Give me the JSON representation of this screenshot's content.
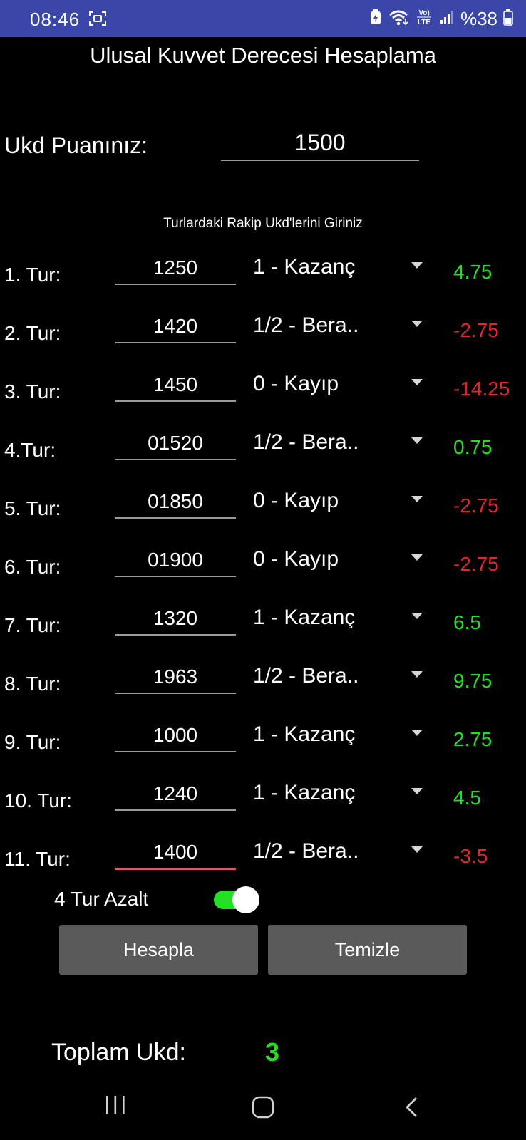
{
  "status_bar": {
    "time": "08:46",
    "battery_text": "%38",
    "left_icon": "screen-capture-icon",
    "right_icons": [
      "battery-saver-icon",
      "wifi-icon",
      "volte-lte-icon",
      "signal-icon",
      "battery-icon"
    ],
    "volte_text": "Vo) LTE",
    "background": "#3a47a8"
  },
  "app": {
    "title": "Ulusal Kuvvet Derecesi Hesaplama",
    "ukd_label": "Ukd Puanınız:",
    "ukd_value": "1500",
    "rivals_header": "Turlardaki Rakip Ukd'lerini Giriniz"
  },
  "colors": {
    "positive": "#22e022",
    "negative": "#e3262a",
    "focus_underline": "#e0566f",
    "button_bg": "#5a5a5a"
  },
  "rounds": [
    {
      "label": "1. Tur:",
      "value": "1250",
      "result": "1 - Kazanç",
      "delta": "4.75",
      "sign": "positive"
    },
    {
      "label": "2. Tur:",
      "value": "1420",
      "result": "1/2 - Bera..",
      "delta": "-2.75",
      "sign": "negative"
    },
    {
      "label": "3. Tur:",
      "value": "1450",
      "result": "0 - Kayıp",
      "delta": "-14.25",
      "sign": "negative"
    },
    {
      "label": "4.Tur:",
      "value": "01520",
      "result": "1/2 - Bera..",
      "delta": "0.75",
      "sign": "positive"
    },
    {
      "label": "5. Tur:",
      "value": "01850",
      "result": "0 - Kayıp",
      "delta": "-2.75",
      "sign": "negative"
    },
    {
      "label": "6. Tur:",
      "value": "01900",
      "result": "0 - Kayıp",
      "delta": "-2.75",
      "sign": "negative"
    },
    {
      "label": "7. Tur:",
      "value": "1320",
      "result": "1 - Kazanç",
      "delta": "6.5",
      "sign": "positive"
    },
    {
      "label": "8. Tur:",
      "value": "1963",
      "result": "1/2 - Bera..",
      "delta": "9.75",
      "sign": "positive"
    },
    {
      "label": "9. Tur:",
      "value": "1000",
      "result": "1 - Kazanç",
      "delta": "2.75",
      "sign": "positive"
    },
    {
      "label": "10. Tur:",
      "value": "1240",
      "result": "1 - Kazanç",
      "delta": "4.5",
      "sign": "positive"
    },
    {
      "label": "11. Tur:",
      "value": "1400",
      "result": "1/2 - Bera..",
      "delta": "-3.5",
      "sign": "negative",
      "focused": true
    }
  ],
  "toggle": {
    "label": "4 Tur Azalt",
    "on": true
  },
  "buttons": {
    "calculate": "Hesapla",
    "clear": "Temizle"
  },
  "total": {
    "label": "Toplam Ukd:",
    "value": "3"
  },
  "nav_bar": {
    "icons": [
      "recents-icon",
      "home-icon",
      "back-icon"
    ]
  }
}
